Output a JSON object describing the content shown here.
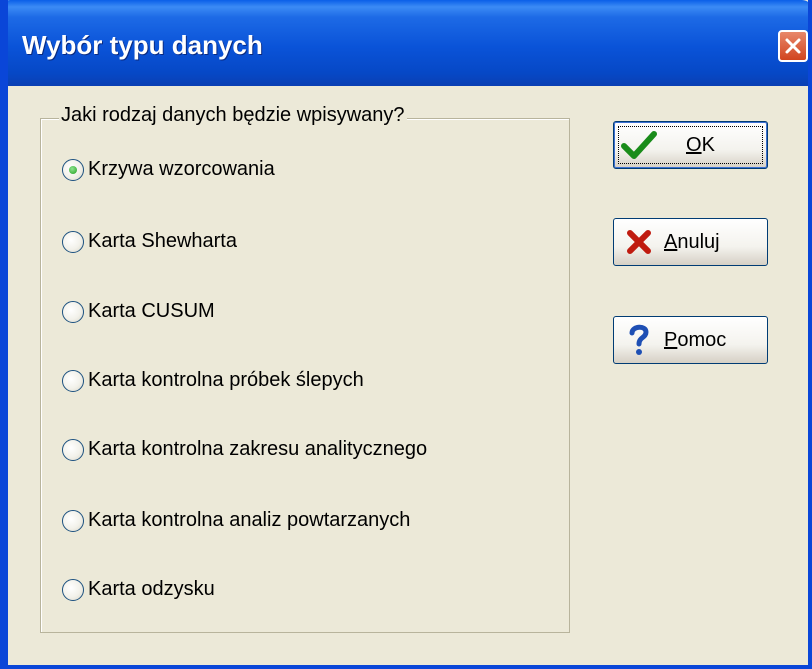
{
  "window": {
    "title": "Wybór typu danych"
  },
  "group": {
    "legend": "Jaki rodzaj danych będzie wpisywany?",
    "options": [
      {
        "label": "Krzywa wzorcowania",
        "selected": true
      },
      {
        "label": "Karta Shewharta",
        "selected": false
      },
      {
        "label": "Karta CUSUM",
        "selected": false
      },
      {
        "label": "Karta kontrolna próbek ślepych",
        "selected": false
      },
      {
        "label": "Karta kontrolna zakresu analitycznego",
        "selected": false
      },
      {
        "label": "Karta kontrolna analiz powtarzanych",
        "selected": false
      },
      {
        "label": "Karta odzysku",
        "selected": false
      }
    ]
  },
  "buttons": {
    "ok": {
      "mnemonic": "O",
      "rest": "K",
      "icon": "checkmark-icon"
    },
    "cancel": {
      "mnemonic": "A",
      "rest": "nuluj",
      "icon": "x-icon"
    },
    "help": {
      "mnemonic": "P",
      "rest": "omoc",
      "icon": "question-icon"
    }
  },
  "colors": {
    "titlebar": "#0a53d8",
    "close": "#d1441f",
    "face": "#ece9d8"
  }
}
